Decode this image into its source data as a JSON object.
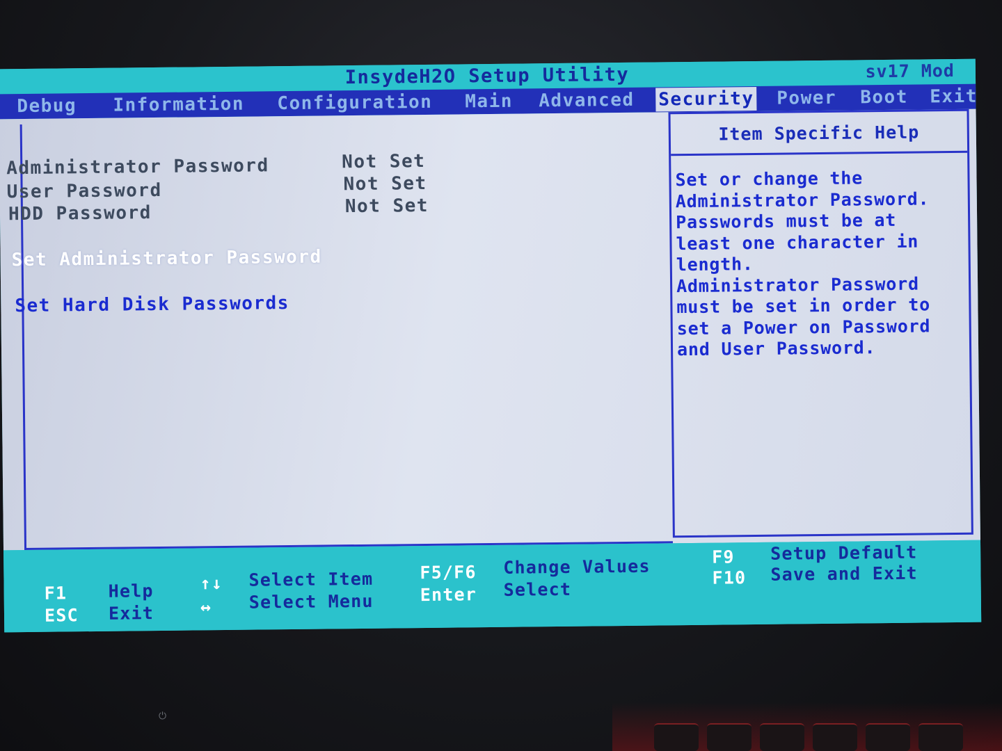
{
  "header": {
    "title": "InsydeH2O Setup Utility",
    "model": "sv17 Mod"
  },
  "menu": {
    "tabs": [
      {
        "label": "Debug"
      },
      {
        "label": "Information"
      },
      {
        "label": "Configuration"
      },
      {
        "label": "Main"
      },
      {
        "label": "Advanced"
      },
      {
        "label": "Security",
        "active": true
      },
      {
        "label": "Power"
      },
      {
        "label": "Boot"
      },
      {
        "label": "Exit"
      }
    ]
  },
  "settings": [
    {
      "label": "Administrator Password",
      "value": "Not Set"
    },
    {
      "label": "User Password",
      "value": "Not Set"
    },
    {
      "label": "HDD Password",
      "value": "Not Set"
    }
  ],
  "actions": {
    "set_admin": "Set Administrator Password",
    "set_hdd": "Set Hard Disk Passwords"
  },
  "help": {
    "title": "Item Specific Help",
    "lines": [
      "Set or change the",
      "Administrator Password.",
      "Passwords must be at",
      "least one character in",
      "length.",
      "Administrator Password",
      "must be set in order to",
      "set a Power on Password",
      "and User Password."
    ]
  },
  "footer": {
    "f1_key": "F1",
    "f1_desc": "Help",
    "esc_key": "ESC",
    "esc_desc": "Exit",
    "updown_key": "↑↓",
    "updown_desc": "Select Item",
    "leftright_key": "↔",
    "leftright_desc": "Select Menu",
    "f5f6_key": "F5/F6",
    "f5f6_desc": "Change Values",
    "enter_key": "Enter",
    "enter_desc": "Select",
    "f9_key": "F9",
    "f9_desc": "Setup Default",
    "f10_key": "F10",
    "f10_desc": "Save and Exit"
  },
  "colors": {
    "title_bar": "#2bc3cd",
    "menu_bar": "#2230b8",
    "main_bg": "#d2d8e8",
    "accent_text": "#1a2bd0"
  }
}
